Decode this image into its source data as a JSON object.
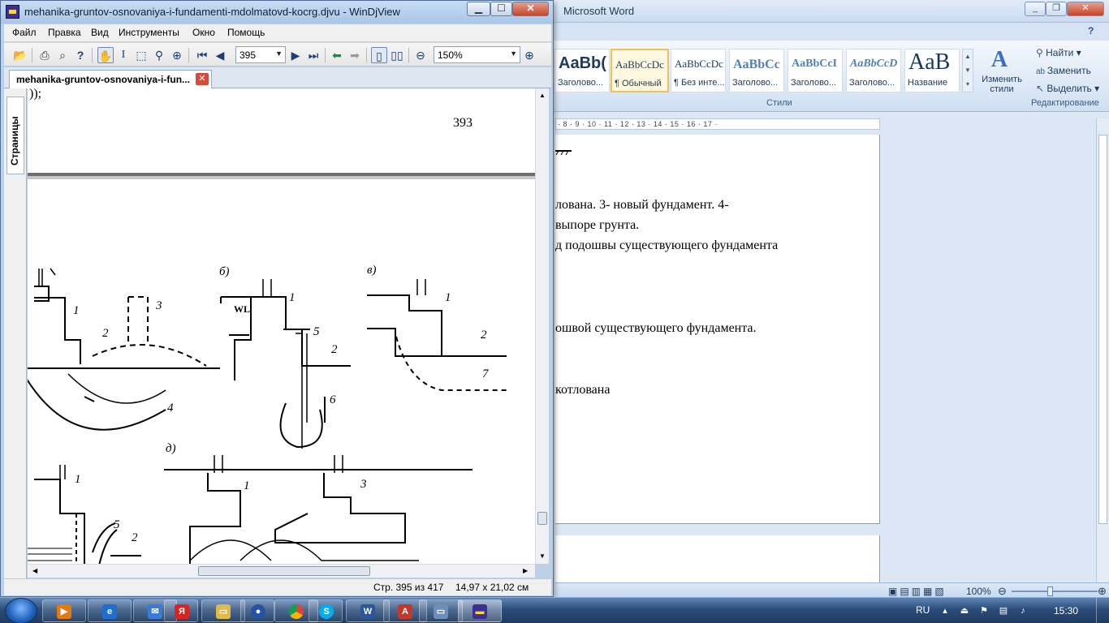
{
  "word": {
    "title": "Microsoft Word",
    "styles": [
      {
        "preview": "AaBb(",
        "name": "Заголово..."
      },
      {
        "preview": "AaBbCcDc",
        "name": "¶ Обычный",
        "selected": true
      },
      {
        "preview": "AaBbCcDc",
        "name": "¶ Без инте..."
      },
      {
        "preview": "AaBbCc",
        "name": "Заголово..."
      },
      {
        "preview": "AaBbCcI",
        "name": "Заголово..."
      },
      {
        "preview": "AaBbCcD",
        "name": "Заголово..."
      },
      {
        "preview": "AaB",
        "name": "Название"
      }
    ],
    "change_styles": "Изменить стили",
    "styles_group": "Стили",
    "edit_group": "Редактирование",
    "find": "Найти",
    "replace": "Заменить",
    "select": "Выделить",
    "ruler": "· 8 · 9 · 10 · 11 · 12 · 13 · 14 · 15 · 16 · 17 ·",
    "lines": [
      "лована. 3- новый фундамент. 4-",
      "выпоре грунта.",
      "д подошвы существующего фундамента",
      "ошвой существующего фундамента.",
      "котлована"
    ],
    "zoom": "100%"
  },
  "djvu": {
    "title": "mehanika-gruntov-osnovaniya-i-fundamenti-mdolmatovd-kocrg.djvu - WinDjView",
    "menu": [
      "Файл",
      "Правка",
      "Вид",
      "Инструменты",
      "Окно",
      "Помощь"
    ],
    "page_input": "395",
    "zoom_select": "150%",
    "tab_label": "mehanika-gruntov-osnovaniya-i-fun...",
    "sidebar_tab": "Страницы",
    "page_number": "393",
    "top_fragment": "));",
    "fig_labels": {
      "b": "б)",
      "v": "в)",
      "d": "д)",
      "wl": "WL",
      "n1": "1",
      "n2": "2",
      "n3": "3",
      "n4": "4",
      "n5": "5",
      "n6": "6",
      "n7": "7"
    },
    "status_page": "Стр. 395 из 417",
    "status_size": "14,97 x 21,02 см"
  },
  "taskbar": {
    "lang": "RU",
    "time": "15:30"
  }
}
